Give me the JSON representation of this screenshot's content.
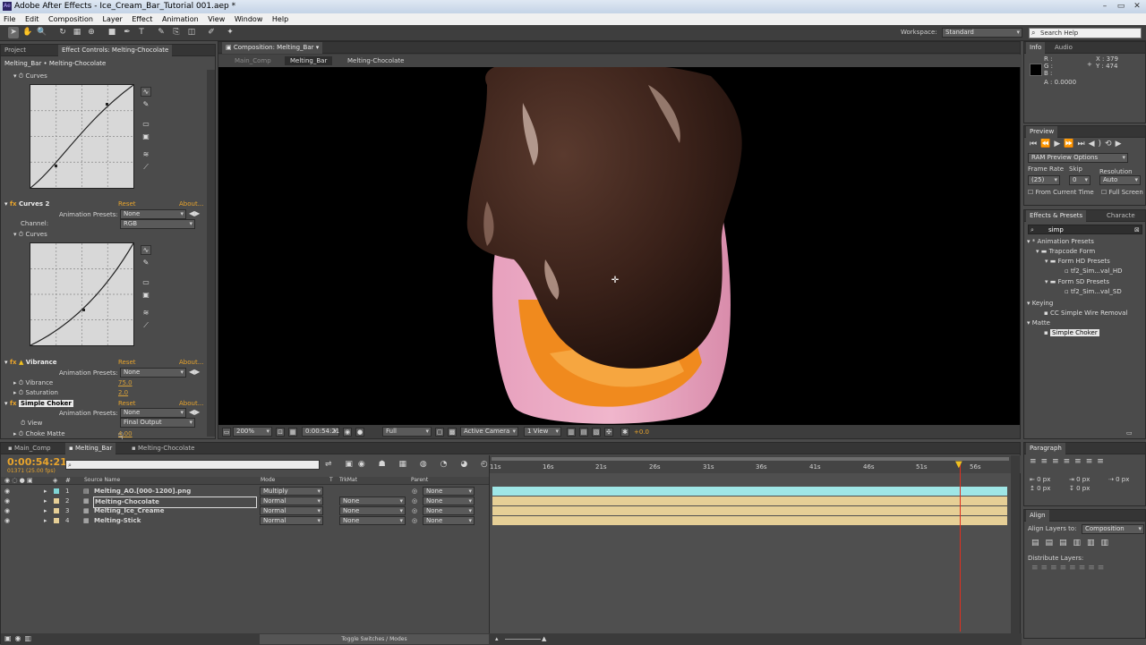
{
  "window": {
    "title": "Adobe After Effects - Ice_Cream_Bar_Tutorial 001.aep *",
    "app_icon": "Ae",
    "min": "–",
    "max": "▭",
    "close": "✕"
  },
  "menu": [
    "File",
    "Edit",
    "Composition",
    "Layer",
    "Effect",
    "Animation",
    "View",
    "Window",
    "Help"
  ],
  "toolbar": {
    "workspace_label": "Workspace:",
    "workspace_value": "Standard",
    "search_placeholder": "Search Help"
  },
  "project_panel": {
    "tabs": [
      "Project",
      "Effect Controls: Melting-Chocolate"
    ],
    "breadcrumb": "Melting_Bar • Melting-Chocolate",
    "curves_label": "Curves",
    "curves2": {
      "name": "Curves 2",
      "reset": "Reset",
      "about": "About...",
      "anim_label": "Animation Presets:",
      "anim_value": "None",
      "channel_label": "Channel:",
      "channel_value": "RGB",
      "curves_label": "Curves"
    },
    "vibrance": {
      "name": "Vibrance",
      "reset": "Reset",
      "about": "About...",
      "anim_label": "Animation Presets:",
      "anim_value": "None",
      "vibrance_label": "Vibrance",
      "vibrance_value": "75.0",
      "saturation_label": "Saturation",
      "saturation_value": "2.0"
    },
    "choker": {
      "name": "Simple Choker",
      "reset": "Reset",
      "about": "About...",
      "anim_label": "Animation Presets:",
      "anim_value": "None",
      "view_label": "View",
      "view_value": "Final Output",
      "choke_label": "Choke Matte",
      "choke_value": "4.00"
    }
  },
  "comp_panel": {
    "tab": "Composition: Melting_Bar",
    "crumbs": [
      "Main_Comp",
      "Melting_Bar",
      "Melting-Chocolate"
    ],
    "footer": {
      "zoom": "200%",
      "timecode": "0:00:54:21",
      "resolution": "Full",
      "camera": "Active Camera",
      "view": "1 View",
      "exposure": "+0.0"
    }
  },
  "info_panel": {
    "tabs": [
      "Info",
      "Audio"
    ],
    "r": "R :",
    "g": "G :",
    "b": "B :",
    "a": "A : 0.0000",
    "x": "X : 379",
    "y": "Y : 474"
  },
  "preview_panel": {
    "tab": "Preview",
    "ram": "RAM Preview Options",
    "fr_label": "Frame Rate",
    "skip_label": "Skip",
    "res_label": "Resolution",
    "fr": "(25)",
    "skip": "0",
    "res": "Auto",
    "from_current": "From Current Time",
    "full_screen": "Full Screen"
  },
  "effects_panel": {
    "tabs": [
      "Effects & Presets",
      "Characte"
    ],
    "search": "simp",
    "tree": [
      "* Animation Presets",
      "Trapcode Form",
      "Form HD Presets",
      "tf2_Sim...val_HD",
      "Form SD Presets",
      "tf2_Sim...val_SD",
      "Keying",
      "CC Simple Wire Removal",
      "Matte",
      "Simple Choker"
    ]
  },
  "paragraph_panel": {
    "tab": "Paragraph",
    "px": [
      "0 px",
      "0 px",
      "0 px",
      "0 px",
      "0 px"
    ]
  },
  "align_panel": {
    "tab": "Align",
    "align_to_label": "Align Layers to:",
    "align_to_value": "Composition",
    "distribute_label": "Distribute Layers:"
  },
  "timeline": {
    "tabs": [
      "Main_Comp",
      "Melting_Bar",
      "Melting-Chocolate"
    ],
    "timecode": "0:00:54:21",
    "frames": "01371 (25.00 fps)",
    "headers": {
      "num": "#",
      "source": "Source Name",
      "mode": "Mode",
      "t": "T",
      "trkmat": "TrkMat",
      "parent": "Parent"
    },
    "layers": [
      {
        "num": "1",
        "name": "Melting_AO.[000-1200].png",
        "mode": "Multiply",
        "trkmat": "",
        "parent": "None",
        "color": "#9fe6e6"
      },
      {
        "num": "2",
        "name": "Melting-Chocolate",
        "mode": "Normal",
        "trkmat": "None",
        "parent": "None",
        "color": "#e6cf96"
      },
      {
        "num": "3",
        "name": "Melting_Ice_Creame",
        "mode": "Normal",
        "trkmat": "None",
        "parent": "None",
        "color": "#e6cf96"
      },
      {
        "num": "4",
        "name": "Melting-Stick",
        "mode": "Normal",
        "trkmat": "None",
        "parent": "None",
        "color": "#e6cf96"
      }
    ],
    "ruler": [
      "11s",
      "16s",
      "21s",
      "26s",
      "31s",
      "36s",
      "41s",
      "46s",
      "51s",
      "56s"
    ],
    "toggle": "Toggle Switches / Modes"
  }
}
